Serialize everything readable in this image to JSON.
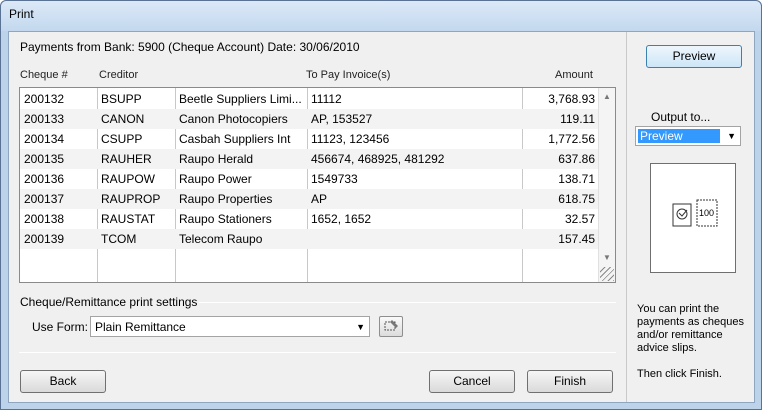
{
  "window": {
    "title": "Print"
  },
  "header": "Payments from Bank: 5900 (Cheque Account) Date: 30/06/2010",
  "table": {
    "columns": [
      "Cheque #",
      "Creditor",
      "To Pay Invoice(s)",
      "Amount"
    ],
    "rows": [
      {
        "cheque": "200132",
        "code": "BSUPP",
        "name": "Beetle Suppliers Limi...",
        "invoices": "11112",
        "amount": "3,768.93"
      },
      {
        "cheque": "200133",
        "code": "CANON",
        "name": "Canon Photocopiers",
        "invoices": "AP, 153527",
        "amount": "119.11"
      },
      {
        "cheque": "200134",
        "code": "CSUPP",
        "name": "Casbah Suppliers Int",
        "invoices": "11123, 123456",
        "amount": "1,772.56"
      },
      {
        "cheque": "200135",
        "code": "RAUHER",
        "name": "Raupo Herald",
        "invoices": "456674, 468925, 481292",
        "amount": "637.86"
      },
      {
        "cheque": "200136",
        "code": "RAUPOW",
        "name": "Raupo Power",
        "invoices": "1549733",
        "amount": "138.71"
      },
      {
        "cheque": "200137",
        "code": "RAUPROP",
        "name": "Raupo Properties",
        "invoices": "AP",
        "amount": "618.75"
      },
      {
        "cheque": "200138",
        "code": "RAUSTAT",
        "name": "Raupo Stationers",
        "invoices": "1652, 1652",
        "amount": "32.57"
      },
      {
        "cheque": "200139",
        "code": "TCOM",
        "name": "Telecom Raupo",
        "invoices": "",
        "amount": "157.45"
      }
    ]
  },
  "settings": {
    "section_label": "Cheque/Remittance print settings",
    "use_form_label": "Use Form:",
    "use_form_value": "Plain Remittance"
  },
  "buttons": {
    "back": "Back",
    "cancel": "Cancel",
    "finish": "Finish",
    "preview": "Preview"
  },
  "output": {
    "label": "Output to...",
    "selected": "Preview",
    "preview_value": "100"
  },
  "help": {
    "line1": "You can print the payments as cheques and/or remittance advice slips.",
    "line2": "Then click Finish."
  }
}
